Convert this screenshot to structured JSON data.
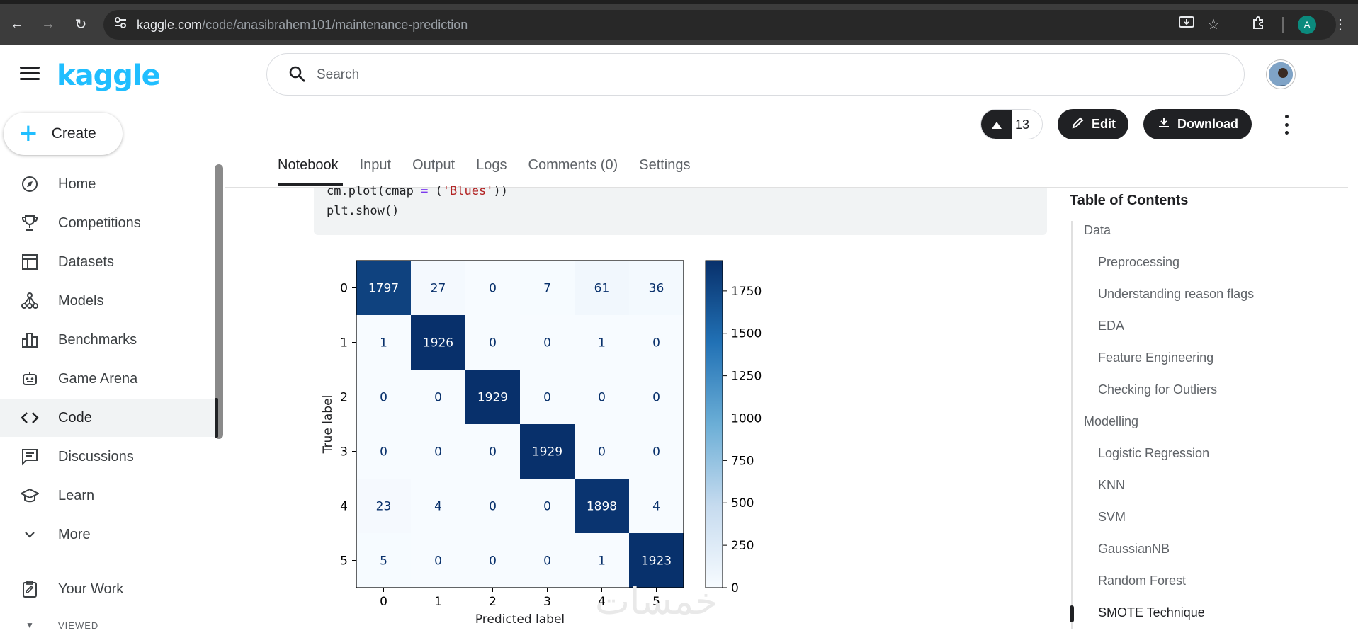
{
  "browser": {
    "url_host": "kaggle.com",
    "url_path": "/code/anasibrahem101/maintenance-prediction",
    "account_initial": "A"
  },
  "sidebar": {
    "logo": "kaggle",
    "create_label": "Create",
    "items": [
      {
        "label": "Home",
        "icon": "compass-icon"
      },
      {
        "label": "Competitions",
        "icon": "trophy-icon"
      },
      {
        "label": "Datasets",
        "icon": "table-icon"
      },
      {
        "label": "Models",
        "icon": "models-icon"
      },
      {
        "label": "Benchmarks",
        "icon": "bar-chart-icon"
      },
      {
        "label": "Game Arena",
        "icon": "robot-icon"
      },
      {
        "label": "Code",
        "icon": "code-icon",
        "active": true
      },
      {
        "label": "Discussions",
        "icon": "discussion-icon"
      },
      {
        "label": "Learn",
        "icon": "school-icon"
      },
      {
        "label": "More",
        "icon": "chevron-down-icon"
      }
    ],
    "your_work": "Your Work",
    "viewed": "VIEWED"
  },
  "header": {
    "search_placeholder": "Search",
    "vote_count": "13",
    "edit_label": "Edit",
    "download_label": "Download"
  },
  "tabs": [
    "Notebook",
    "Input",
    "Output",
    "Logs",
    "Comments (0)",
    "Settings"
  ],
  "code": {
    "line1_pre": "cm.plot(cmap ",
    "line1_op": "=",
    "line1_mid": " (",
    "line1_str": "'Blues'",
    "line1_post": "))",
    "line2": "plt.show()"
  },
  "chart_data": {
    "type": "heatmap",
    "xlabel": "Predicted label",
    "ylabel": "True label",
    "x_categories": [
      "0",
      "1",
      "2",
      "3",
      "4",
      "5"
    ],
    "y_categories": [
      "0",
      "1",
      "2",
      "3",
      "4",
      "5"
    ],
    "matrix": [
      [
        1797,
        27,
        0,
        7,
        61,
        36
      ],
      [
        1,
        1926,
        0,
        0,
        1,
        0
      ],
      [
        0,
        0,
        1929,
        0,
        0,
        0
      ],
      [
        0,
        0,
        0,
        1929,
        0,
        0
      ],
      [
        23,
        4,
        0,
        0,
        1898,
        4
      ],
      [
        5,
        0,
        0,
        0,
        1,
        1923
      ]
    ],
    "colormap": "Blues",
    "colorbar_ticks": [
      0,
      250,
      500,
      750,
      1000,
      1250,
      1500,
      1750
    ],
    "colorbar_range": [
      0,
      1929
    ]
  },
  "toc": {
    "title": "Table of Contents",
    "items": [
      {
        "label": "Data",
        "level": 1
      },
      {
        "label": "Preprocessing",
        "level": 2
      },
      {
        "label": "Understanding reason flags",
        "level": 2
      },
      {
        "label": "EDA",
        "level": 2
      },
      {
        "label": "Feature Engineering",
        "level": 2
      },
      {
        "label": "Checking for Outliers",
        "level": 2
      },
      {
        "label": "Modelling",
        "level": 1
      },
      {
        "label": "Logistic Regression",
        "level": 2
      },
      {
        "label": "KNN",
        "level": 2
      },
      {
        "label": "SVM",
        "level": 2
      },
      {
        "label": "GaussianNB",
        "level": 2
      },
      {
        "label": "Random Forest",
        "level": 2
      },
      {
        "label": "SMOTE Technique",
        "level": 2,
        "current": true
      }
    ]
  },
  "watermark": "خمسات",
  "colors": {
    "kaggle_blue": "#20beff",
    "dark": "#202124",
    "heatmap_low": "#f7fbff",
    "heatmap_high": "#08306b"
  }
}
